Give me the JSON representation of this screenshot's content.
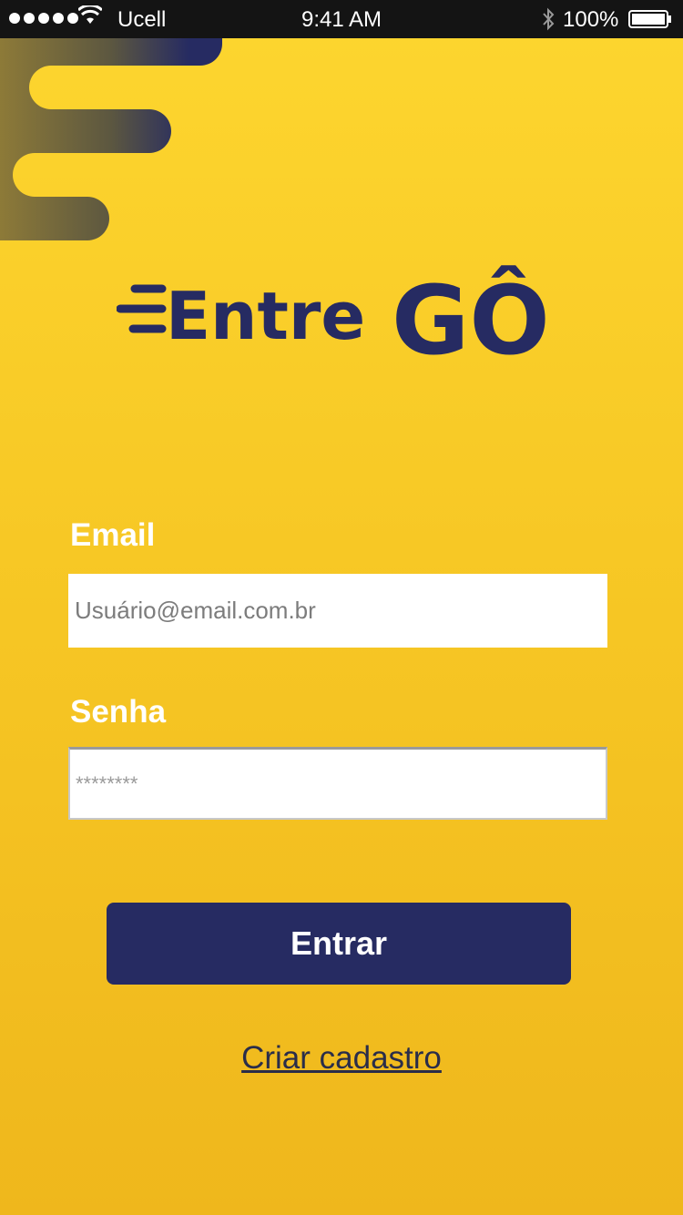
{
  "status_bar": {
    "carrier": "Ucell",
    "time": "9:41 AM",
    "battery": "100%",
    "icons": [
      "signal-dots-icon",
      "wifi-icon",
      "bluetooth-icon",
      "battery-icon"
    ]
  },
  "brand": {
    "logo_text_part1": "Entre",
    "logo_text_part2": "GÔ",
    "primary_color": "#262b62",
    "background_color": "#fdd62f"
  },
  "form": {
    "email_label": "Email",
    "email_placeholder": "Usuário@email.com.br",
    "password_label": "Senha",
    "password_placeholder": "********",
    "submit_label": "Entrar",
    "signup_link": "Criar cadastro"
  }
}
